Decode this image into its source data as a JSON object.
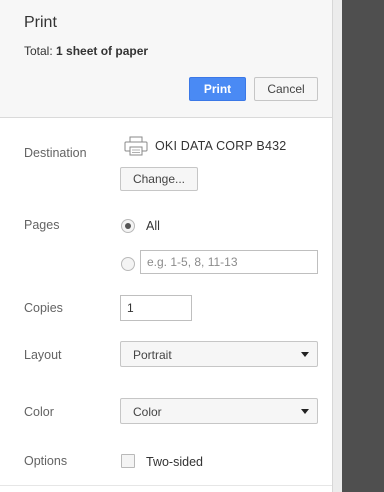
{
  "dialog": {
    "title": "Print",
    "summary_prefix": "Total: ",
    "summary_value": "1 sheet of paper",
    "print_label": "Print",
    "cancel_label": "Cancel"
  },
  "destination": {
    "label": "Destination",
    "printer_name": "OKI DATA CORP B432",
    "change_label": "Change...",
    "icon": "printer-icon"
  },
  "pages": {
    "label": "Pages",
    "all_label": "All",
    "all_selected": true,
    "range_placeholder": "e.g. 1-5, 8, 11-13",
    "range_value": ""
  },
  "copies": {
    "label": "Copies",
    "value": "1"
  },
  "layout": {
    "label": "Layout",
    "selected": "Portrait"
  },
  "color": {
    "label": "Color",
    "selected": "Color"
  },
  "options": {
    "label": "Options",
    "two_sided_label": "Two-sided",
    "two_sided_checked": false
  },
  "colors": {
    "primary_button": "#4a8af4",
    "preview_background": "#4f4f4f",
    "header_background": "#f7f7f7"
  }
}
